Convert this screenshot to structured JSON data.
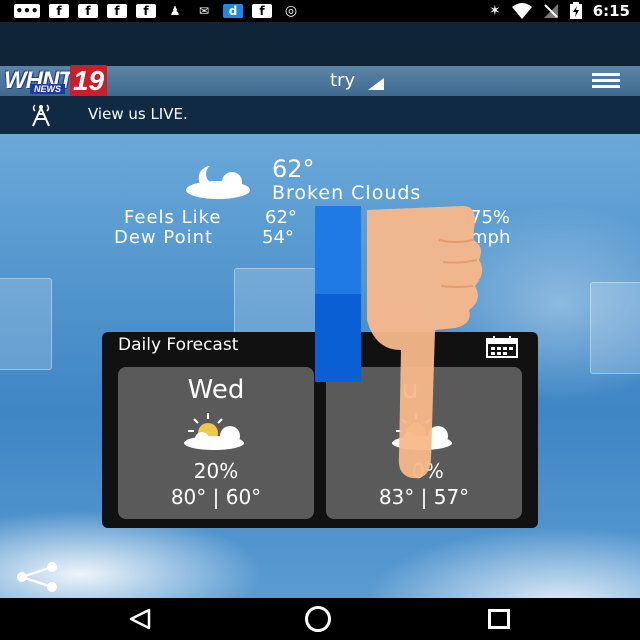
{
  "status_bar": {
    "notif_letters": [
      "f",
      "f",
      "f",
      "f",
      "f",
      "d",
      "f"
    ],
    "time": "6:15",
    "icons": [
      "more-icon",
      "facebook-icon",
      "facebook-icon",
      "facebook-icon",
      "facebook-icon",
      "figure-icon",
      "message-icon",
      "dictionary-icon",
      "facebook-icon",
      "record-icon",
      "bluetooth-icon",
      "wifi-icon",
      "no-signal-icon",
      "battery-charging-icon"
    ]
  },
  "header": {
    "logo_letters": "WHNT",
    "logo_number": "19",
    "logo_sub": "NEWS",
    "location_label": "try",
    "menu_icon": "hamburger-menu-icon"
  },
  "live": {
    "icon": "broadcast-tower-icon",
    "label": "View us LIVE."
  },
  "current": {
    "icon": "moon-cloud-icon",
    "temperature": "62°",
    "condition": "Broken Clouds",
    "feels_like_label": "Feels Like",
    "feels_like_value": "62°",
    "dew_point_label": "Dew Point",
    "dew_point_value": "54°",
    "right_value_1": "75%",
    "right_value_2": "mph"
  },
  "forecast": {
    "title": "Daily Forecast",
    "calendar_icon": "calendar-icon",
    "days": [
      {
        "name": "Wed",
        "icon": "partly-sunny-icon",
        "precip": "20%",
        "hi_lo": "80° | 60°"
      },
      {
        "name": "u",
        "icon": "partly-sunny-icon",
        "precip": "0%",
        "hi_lo": "83° | 57°"
      }
    ]
  },
  "share_icon": "share-icon",
  "navbar": {
    "back": "back-icon",
    "home": "home-icon",
    "recent": "recent-apps-icon"
  },
  "colors": {
    "status_bg": "#000000",
    "header_bg": "#4a7599",
    "live_bg": "#102a44",
    "forecast_bg": "#111111",
    "card_bg": "#5a5a5a",
    "overlay_blue": "#1f7ae6",
    "hand": "#f8b88b"
  }
}
